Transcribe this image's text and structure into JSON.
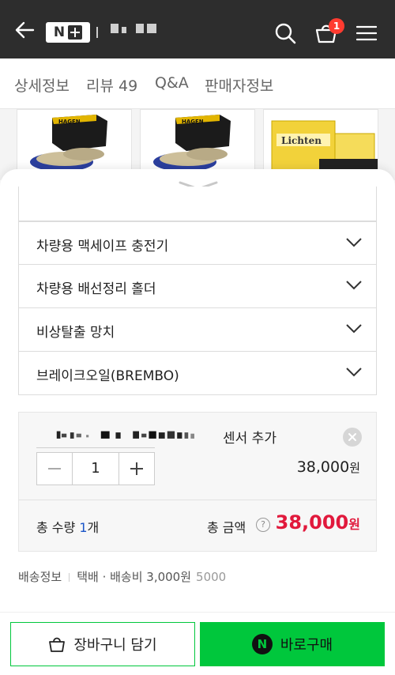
{
  "header": {
    "back_icon": "arrow-left-icon",
    "logo_letter": "N",
    "cart_badge": "1",
    "icons": [
      "search-icon",
      "cart-icon",
      "menu-icon"
    ]
  },
  "tabs": [
    {
      "label": "상세정보"
    },
    {
      "label": "리뷰 49"
    },
    {
      "label": "Q&A"
    },
    {
      "label": "판매자정보"
    }
  ],
  "thumbnails": [
    {
      "brand": "HAGEN"
    },
    {
      "brand": "HAGEN"
    },
    {
      "brand": "Lichten"
    }
  ],
  "options": [
    {
      "label": ""
    },
    {
      "label": "차량용 맥세이프 충전기"
    },
    {
      "label": "차량용 배선정리 홀더"
    },
    {
      "label": "비상탈출 망치"
    },
    {
      "label": "브레이크오일(BREMBO)"
    }
  ],
  "selected": {
    "name_suffix": "센서 추가",
    "quantity": "1",
    "price": "38,000",
    "price_unit": "원",
    "remove_icon": "close-icon"
  },
  "total": {
    "qty_label": "총 수량",
    "qty_value": "1",
    "qty_unit": "개",
    "amount_label": "총 금액",
    "amount": "38,000",
    "amount_unit": "원"
  },
  "shipping": {
    "label": "배송정보",
    "method": "택배 · 배송비 3,000원",
    "extra": "5000"
  },
  "buttons": {
    "cart_label": "장바구니 담기",
    "buy_label": "바로구매",
    "npay_letter": "N"
  },
  "colors": {
    "header_bg": "#2d2d2d",
    "accent_green": "#00c73c",
    "price_red": "#e1193c",
    "qty_blue": "#1a55c8",
    "badge_red": "#ff3b30"
  }
}
